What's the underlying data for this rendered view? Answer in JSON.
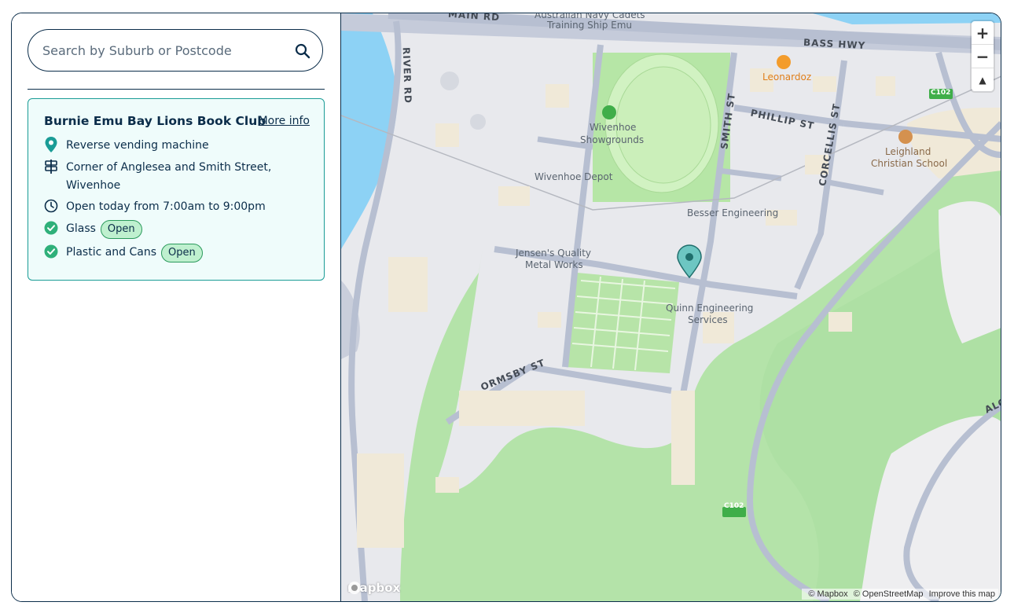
{
  "search": {
    "placeholder": "Search by Suburb or Postcode",
    "icon": "search-icon"
  },
  "card": {
    "title": "Burnie Emu Bay Lions Book Club",
    "more_info": "More info",
    "type": "Reverse vending machine",
    "address_line1": "Corner of Anglesea and Smith Street,",
    "address_line2": "Wivenhoe",
    "hours": "Open today from 7:00am to 9:00pm",
    "materials": [
      {
        "name": "Glass",
        "status": "Open"
      },
      {
        "name": "Plastic and Cans",
        "status": "Open"
      }
    ]
  },
  "map": {
    "places": {
      "navy": "Australian Navy Cadets",
      "navy2": "Training Ship Emu",
      "showgrounds1": "Wivenhoe",
      "showgrounds2": "Showgrounds",
      "depot": "Wivenhoe Depot",
      "besser": "Besser Engineering",
      "jensen1": "Jensen's Quality",
      "jensen2": "Metal Works",
      "quinn1": "Quinn Engineering",
      "quinn2": "Services",
      "leonardoz": "Leonardoz",
      "leighland1": "Leighland",
      "leighland2": "Christian School"
    },
    "roads": {
      "main": "MAIN RD",
      "bass": "BASS HWY",
      "river": "RIVER RD",
      "smith": "SMITH ST",
      "phillip": "PHILLIP ST",
      "corcellis": "CORCELLIS ST",
      "ormsby": "ORMSBY ST",
      "alo": "ALO",
      "c102a": "C102",
      "c102b": "C102"
    },
    "zoom_in": "+",
    "zoom_out": "−",
    "compass": "▲",
    "logo": "mapbox",
    "attribution": [
      "© Mapbox",
      "© OpenStreetMap",
      "Improve this map"
    ],
    "colors": {
      "water": "#8dd2f5",
      "park": "#b4e3a9",
      "land": "#e8e9ed",
      "road": "#b7bfd1",
      "pin": "#2aa7a0"
    }
  }
}
